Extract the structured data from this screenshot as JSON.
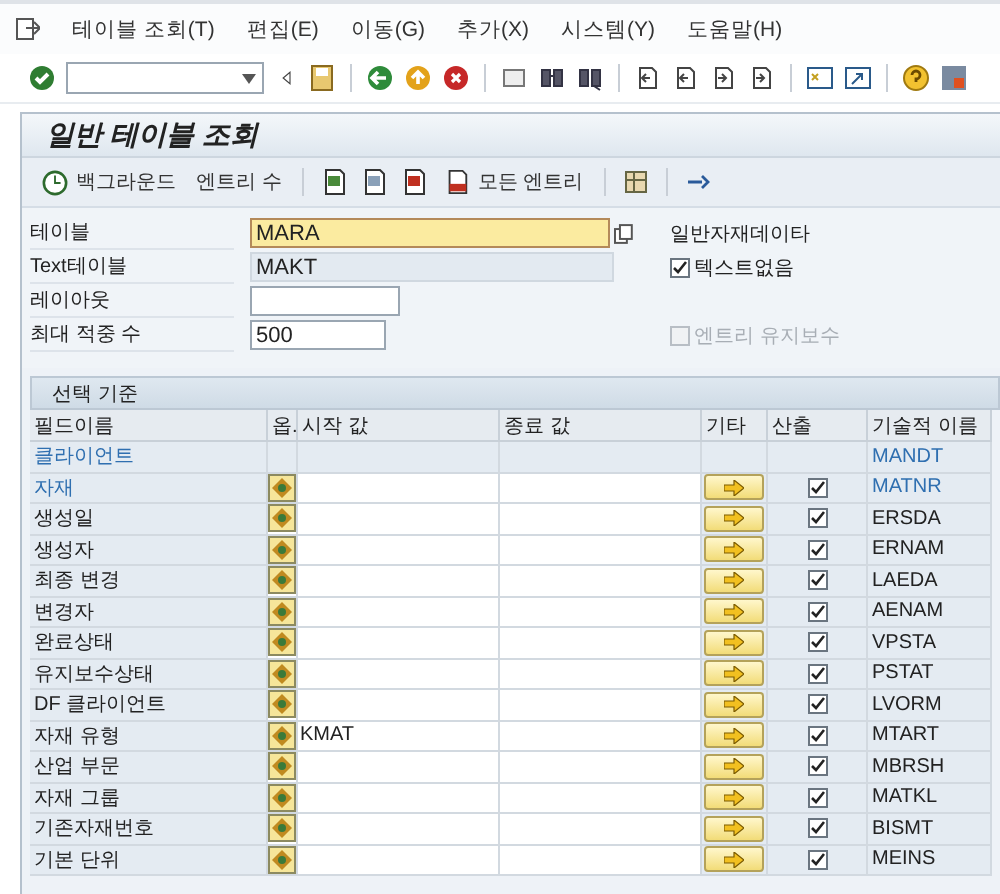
{
  "menu": [
    {
      "label": "테이블 조회(T)"
    },
    {
      "label": "편집(E)"
    },
    {
      "label": "이동(G)"
    },
    {
      "label": "추가(X)"
    },
    {
      "label": "시스템(Y)"
    },
    {
      "label": "도움말(H)"
    }
  ],
  "title": "일반 테이블 조회",
  "app_toolbar": [
    {
      "kind": "icon-text",
      "label": "백그라운드"
    },
    {
      "kind": "text",
      "label": "엔트리 수"
    },
    {
      "kind": "icon-text",
      "label": "모든 엔트리"
    }
  ],
  "form": {
    "fields": [
      {
        "label": "테이블",
        "value": "MARA",
        "focused": true,
        "readonly": false
      },
      {
        "label": "Text테이블",
        "value": "MAKT",
        "focused": false,
        "readonly": true
      },
      {
        "label": "레이아웃",
        "focused": false,
        "readonly": false
      },
      {
        "label": "최대 적중 수",
        "value": "500",
        "focused": false,
        "readonly": false
      }
    ],
    "table_description": "일반자재데이타",
    "options": [
      {
        "label": "텍스트없음",
        "checked": true,
        "disabled": false
      },
      {
        "label": "엔트리 유지보수",
        "checked": false,
        "disabled": true
      }
    ]
  },
  "selection": {
    "title": "선택 기준",
    "columns": [
      "필드이름",
      "옵.",
      "시작 값",
      "종료 값",
      "기타",
      "산출",
      "기술적 이름"
    ],
    "rows": [
      {
        "name": "클라이언트",
        "key": true,
        "kind": "fixed",
        "tech": "MANDT"
      },
      {
        "name": "자재",
        "key": true,
        "kind": "field",
        "output": true,
        "tech": "MATNR"
      },
      {
        "name": "생성일",
        "key": false,
        "kind": "field",
        "output": true,
        "tech": "ERSDA"
      },
      {
        "name": "생성자",
        "key": false,
        "kind": "field",
        "output": true,
        "tech": "ERNAM"
      },
      {
        "name": "최종 변경",
        "key": false,
        "kind": "field",
        "output": true,
        "tech": "LAEDA"
      },
      {
        "name": "변경자",
        "key": false,
        "kind": "field",
        "output": true,
        "tech": "AENAM"
      },
      {
        "name": "완료상태",
        "key": false,
        "kind": "field",
        "output": true,
        "tech": "VPSTA"
      },
      {
        "name": "유지보수상태",
        "key": false,
        "kind": "field",
        "output": true,
        "tech": "PSTAT"
      },
      {
        "name": "DF 클라이언트",
        "key": false,
        "kind": "field",
        "output": true,
        "tech": "LVORM"
      },
      {
        "name": "자재 유형",
        "key": false,
        "kind": "field",
        "from": "KMAT",
        "output": true,
        "tech": "MTART"
      },
      {
        "name": "산업 부문",
        "key": false,
        "kind": "field",
        "output": true,
        "tech": "MBRSH"
      },
      {
        "name": "자재 그룹",
        "key": false,
        "kind": "field",
        "output": true,
        "tech": "MATKL"
      },
      {
        "name": "기존자재번호",
        "key": false,
        "kind": "field",
        "output": true,
        "tech": "BISMT"
      },
      {
        "name": "기본 단위",
        "key": false,
        "kind": "field",
        "output": true,
        "tech": "MEINS"
      }
    ]
  }
}
